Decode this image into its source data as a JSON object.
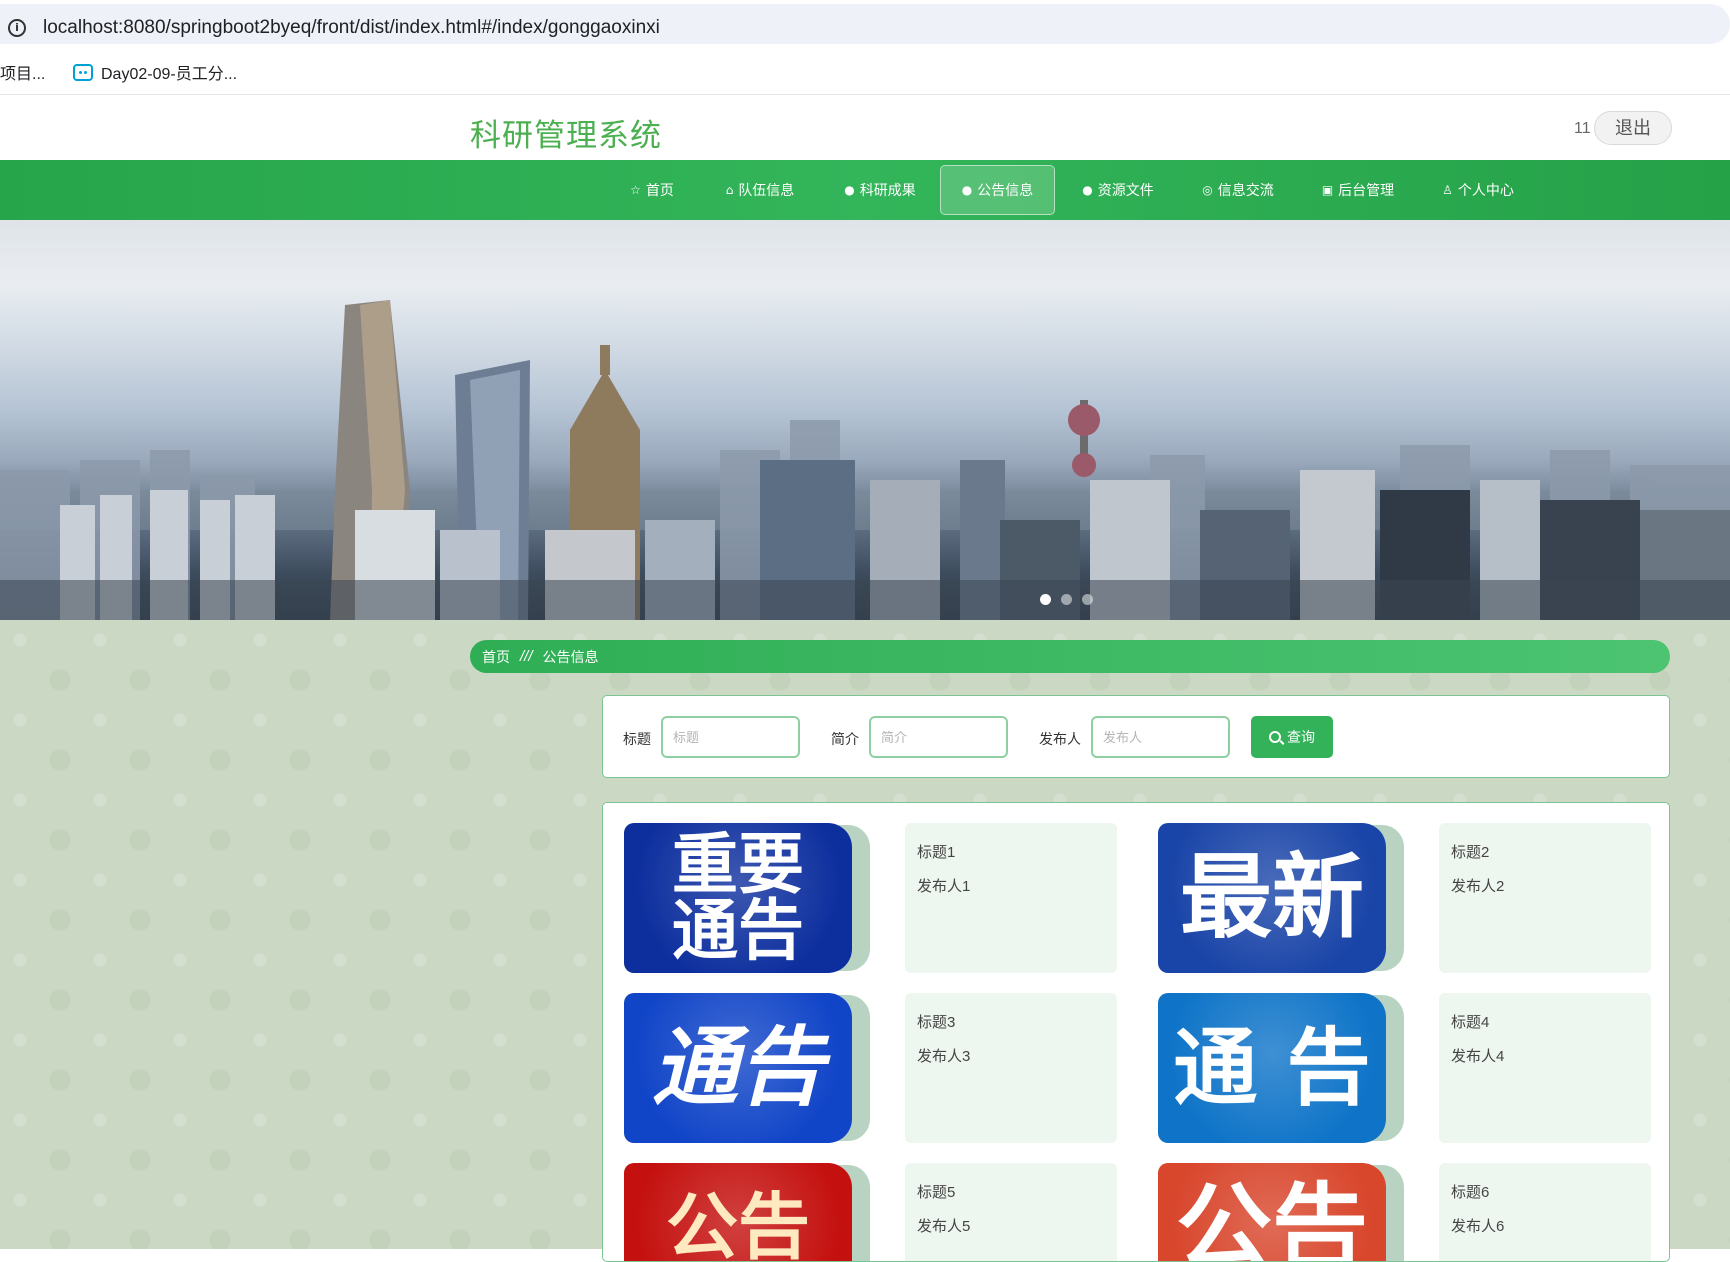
{
  "browser": {
    "url": "localhost:8080/springboot2byeq/front/dist/index.html#/index/gonggaoxinxi",
    "bookmarks": [
      "项目...",
      "Day02-09-员工分..."
    ]
  },
  "header": {
    "site_title": "科研管理系统",
    "user_count": "11",
    "logout_label": "退出"
  },
  "nav": {
    "items": [
      {
        "label": "首页",
        "icon": "star-icon"
      },
      {
        "label": "队伍信息",
        "icon": "bag-icon"
      },
      {
        "label": "科研成果",
        "icon": "info-icon"
      },
      {
        "label": "公告信息",
        "icon": "help-icon",
        "active": true
      },
      {
        "label": "资源文件",
        "icon": "info-icon"
      },
      {
        "label": "信息交流",
        "icon": "chat-icon"
      },
      {
        "label": "后台管理",
        "icon": "clipboard-icon"
      },
      {
        "label": "个人中心",
        "icon": "user-icon"
      }
    ]
  },
  "breadcrumb": {
    "home": "首页",
    "separator": "///",
    "current": "公告信息"
  },
  "search": {
    "title_label": "标题",
    "title_placeholder": "标题",
    "intro_label": "简介",
    "intro_placeholder": "简介",
    "publisher_label": "发布人",
    "publisher_placeholder": "发布人",
    "query_label": "查询"
  },
  "notices": [
    {
      "image_text": "重要\n通告",
      "title": "标题1",
      "publisher": "发布人1",
      "color": "#0d2f9e"
    },
    {
      "image_text": "最新",
      "title": "标题2",
      "publisher": "发布人2",
      "color": "#1a45a8"
    },
    {
      "image_text": "通告",
      "title": "标题3",
      "publisher": "发布人3",
      "color": "#1145c8"
    },
    {
      "image_text": "通 告",
      "title": "标题4",
      "publisher": "发布人4",
      "color": "#0f74c8"
    },
    {
      "image_text": "公告",
      "title": "标题5",
      "publisher": "发布人5",
      "color": "#c4110f"
    },
    {
      "image_text": "公告",
      "title": "标题6",
      "publisher": "发布人6",
      "color": "#d8462c"
    }
  ]
}
